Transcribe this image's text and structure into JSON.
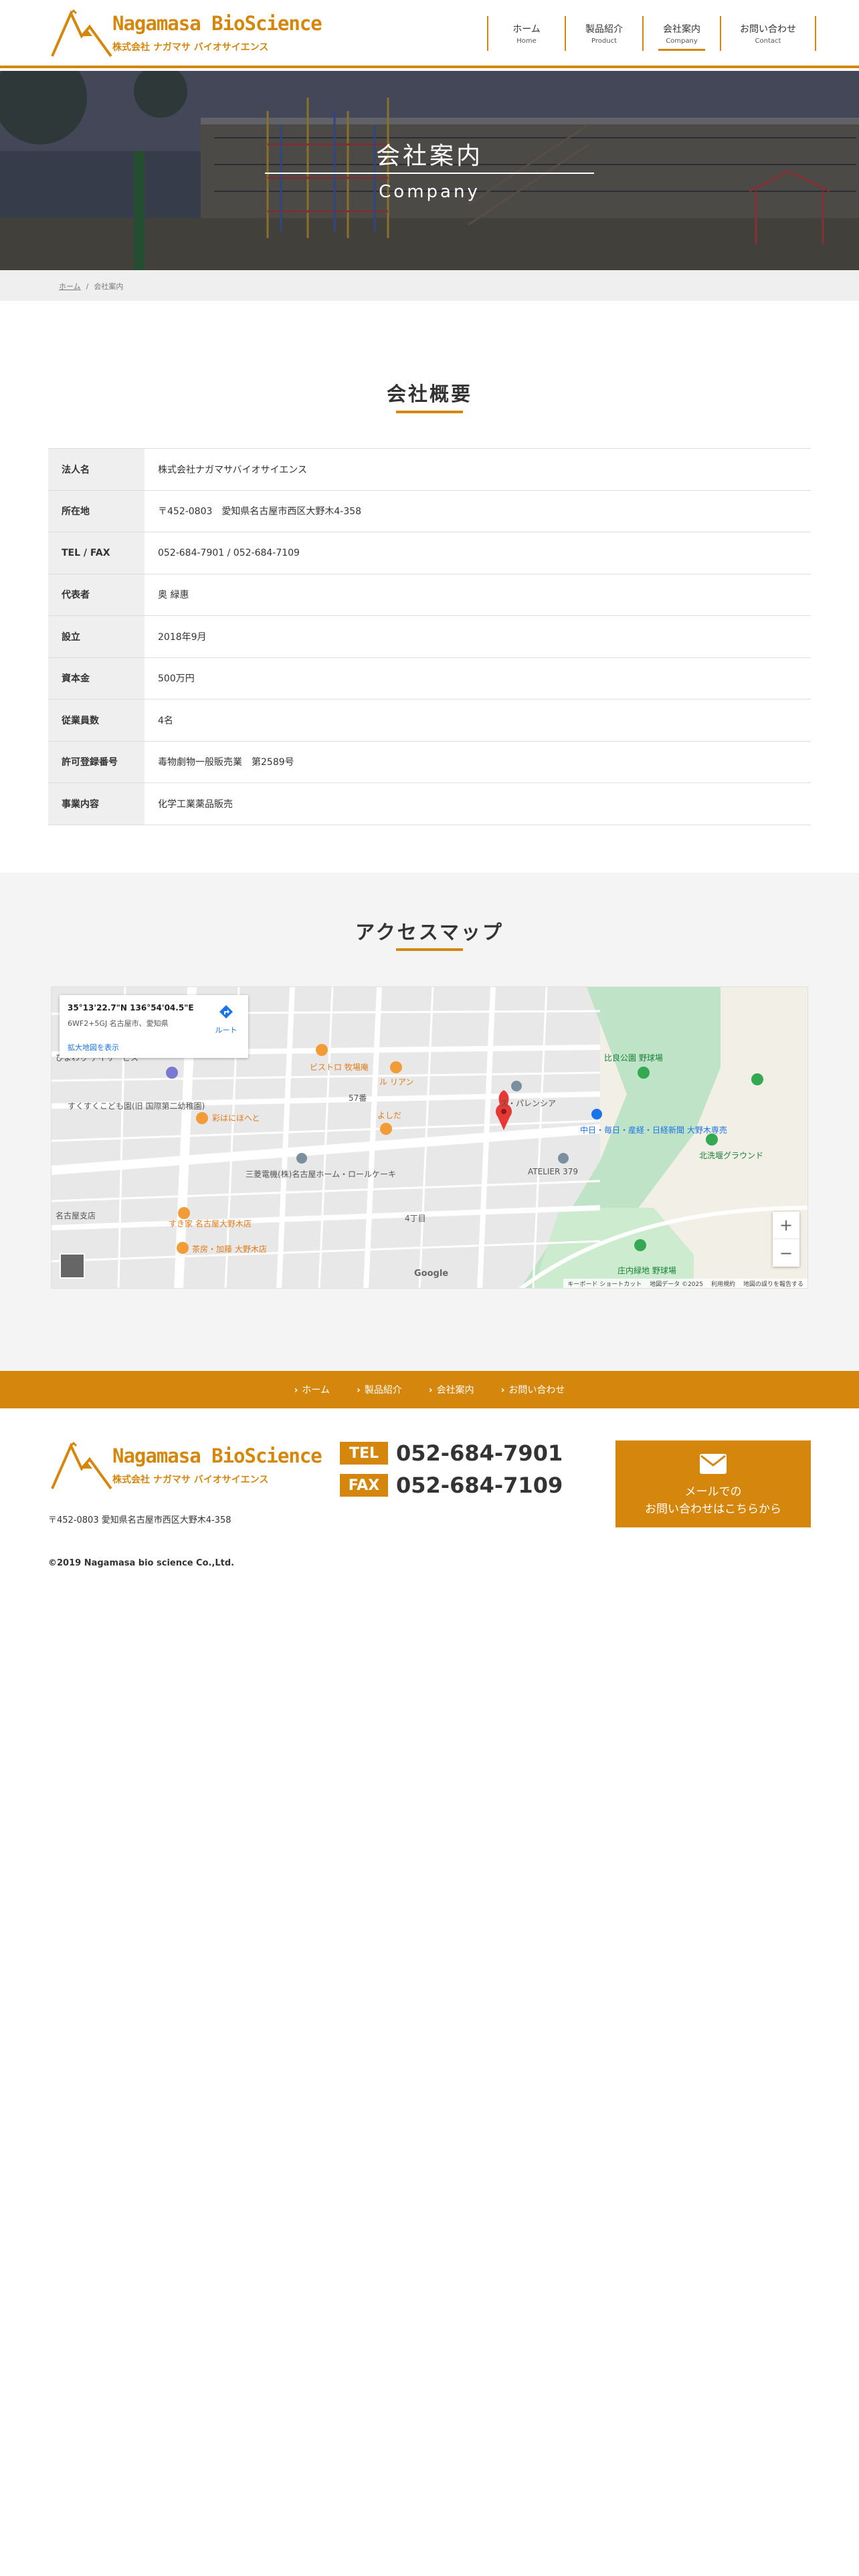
{
  "brand": {
    "name_en": "Nagamasa BioScience",
    "name_jp": "株式会社 ナガマサ バイオサイエンス",
    "color": "#d4870c"
  },
  "nav": [
    {
      "jp": "ホーム",
      "en": "Home"
    },
    {
      "jp": "製品紹介",
      "en": "Product"
    },
    {
      "jp": "会社案内",
      "en": "Company"
    },
    {
      "jp": "お問い合わせ",
      "en": "Contact"
    }
  ],
  "hero": {
    "title": "会社案内",
    "subtitle": "Company"
  },
  "breadcrumb": {
    "home": "ホーム",
    "separator": "/",
    "current": "会社案内"
  },
  "overview": {
    "title": "会社概要",
    "rows": [
      {
        "label": "法人名",
        "value": "株式会社ナガマサバイオサイエンス"
      },
      {
        "label": "所在地",
        "value": "〒452-0803　愛知県名古屋市西区大野木4-358"
      },
      {
        "label": "TEL / FAX",
        "value": "052-684-7901 / 052-684-7109"
      },
      {
        "label": "代表者",
        "value": "奥 緑惠"
      },
      {
        "label": "設立",
        "value": "2018年9月"
      },
      {
        "label": "資本金",
        "value": "500万円"
      },
      {
        "label": "従業員数",
        "value": "4名"
      },
      {
        "label": "許可登録番号",
        "value": "毒物劇物一般販売業　第2589号"
      },
      {
        "label": "事業内容",
        "value": "化学工業薬品販売"
      }
    ]
  },
  "access": {
    "title": "アクセスマップ",
    "map": {
      "coords": "35°13'22.7\"N 136°54'04.5\"E",
      "address": "6WF2+5GJ 名古屋市、愛知県",
      "enlarge": "拡大地図を表示",
      "route": "ルート",
      "zoom_in": "+",
      "zoom_out": "−",
      "google": "Google",
      "attribution": [
        "キーボード ショートカット",
        "地図データ ©2025",
        "利用規約",
        "地図の誤りを報告する"
      ],
      "places": [
        "ビストロ 牧場庵",
        "ル リアン",
        "よしだ",
        "彩はにほへと",
        "ス・パレンシア",
        "中日・毎日・産経・日経新聞 大野木専売",
        "ATELIER 379",
        "すき家 名古屋大野木店",
        "茶房・加藤 大野木店",
        "庄内緑地 野球場",
        "比良公園 野球場",
        "北洗堰グラウンド",
        "すくすくこども園(旧 国際第二幼稚園)",
        "ひまわり デイサービス",
        "三菱電機(株)名古屋ホーム・ロールケーキ",
        "名古屋支店",
        "57番",
        "4丁目"
      ]
    }
  },
  "footer": {
    "nav": [
      "ホーム",
      "製品紹介",
      "会社案内",
      "お問い合わせ"
    ],
    "address": "〒452-0803 愛知県名古屋市西区大野木4-358",
    "tel_label": "TEL",
    "tel": "052-684-7901",
    "fax_label": "FAX",
    "fax": "052-684-7109",
    "mail_line1": "メールでの",
    "mail_line2": "お問い合わせはこちらから",
    "copyright": "©2019 Nagamasa bio science Co.,Ltd."
  }
}
